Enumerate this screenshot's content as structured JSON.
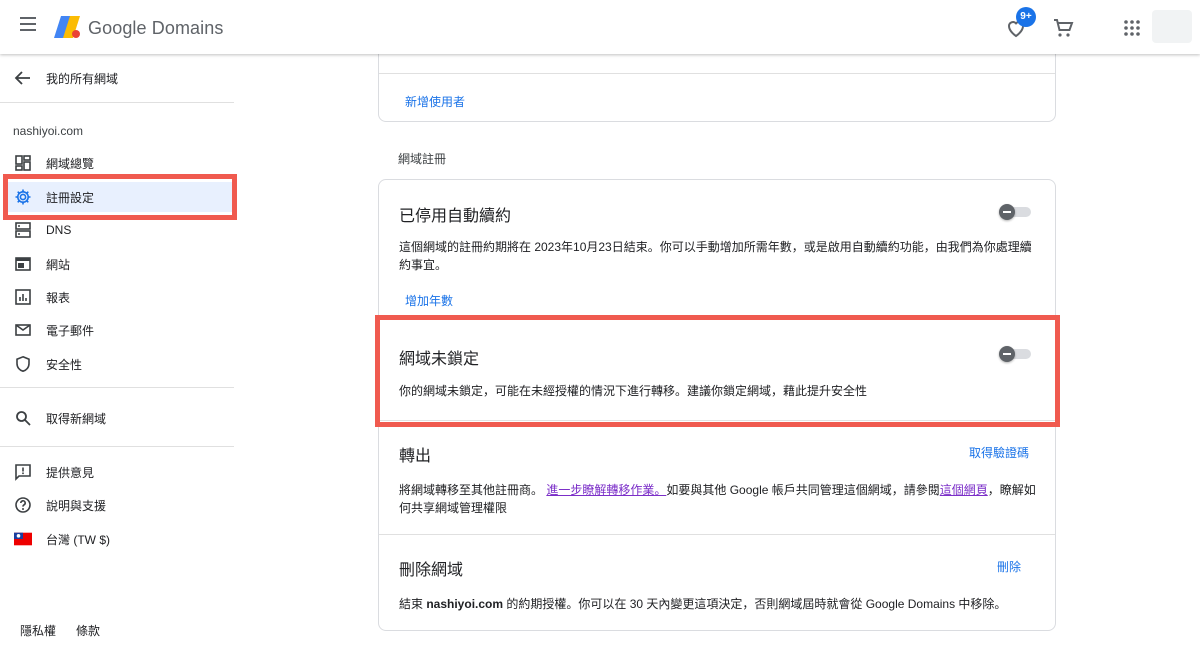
{
  "header": {
    "brand": "Google Domains",
    "badge": "9+"
  },
  "sidebar": {
    "back_label": "我的所有網域",
    "domain": "nashiyoi.com",
    "items": [
      {
        "label": "網域總覽",
        "icon": "dashboard-icon"
      },
      {
        "label": "註冊設定",
        "icon": "gear-icon"
      },
      {
        "label": "DNS",
        "icon": "dns-icon"
      },
      {
        "label": "網站",
        "icon": "website-icon"
      },
      {
        "label": "報表",
        "icon": "report-icon"
      },
      {
        "label": "電子郵件",
        "icon": "mail-icon"
      },
      {
        "label": "安全性",
        "icon": "shield-icon"
      }
    ],
    "get_new_domain": "取得新網域",
    "feedback": "提供意見",
    "help": "說明與支援",
    "region": "台灣 (TW $)",
    "footer": {
      "privacy": "隱私權",
      "terms": "條款"
    }
  },
  "main": {
    "add_user": "新增使用者",
    "section_title": "網域註冊",
    "autorenew": {
      "title": "已停用自動續約",
      "text": "這個網域的註冊約期將在 2023年10月23日結束。你可以手動增加所需年數，或是啟用自動續約功能，由我們為你處理續約事宜。",
      "link": "增加年數"
    },
    "lock": {
      "title": "網域未鎖定",
      "text": "你的網域未鎖定，可能在未經授權的情況下進行轉移。建議你鎖定網域，藉此提升安全性"
    },
    "transfer": {
      "title": "轉出",
      "action": "取得驗證碼",
      "text_pre": "將網域轉移至其他註冊商。",
      "text_link1": "進一步瞭解轉移作業。",
      "text_mid": "如要與其他 Google 帳戶共同管理這個網域，請參閱",
      "text_link2": "這個網頁",
      "text_post": "，瞭解如何共享網域管理權限"
    },
    "delete": {
      "title": "刪除網域",
      "action": "刪除",
      "text_pre": "結束 ",
      "domain": "nashiyoi.com",
      "text_post": " 的約期授權。你可以在 30 天內變更這項決定，否則網域屆時就會從 Google Domains 中移除。"
    }
  },
  "colors": {
    "accent": "#1a73e8",
    "highlight_border": "#f05a4f",
    "active_bg": "#e8f0fe",
    "visited_link": "#7b2ec8"
  }
}
